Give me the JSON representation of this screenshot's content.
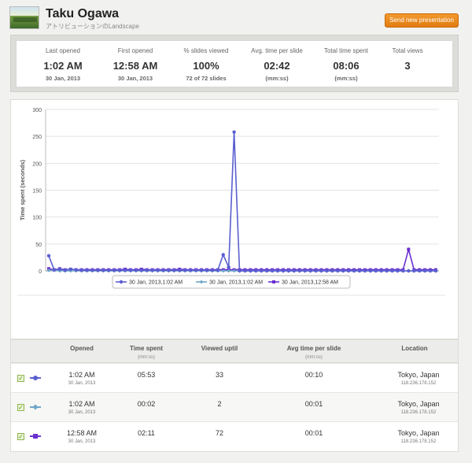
{
  "header": {
    "name": "Taku Ogawa",
    "presentation_title": "アトリビューションのLandscape",
    "send_button": "Send new presentation"
  },
  "stats": [
    {
      "label": "Last opened",
      "value": "1:02 AM",
      "sub": "30 Jan, 2013"
    },
    {
      "label": "First opened",
      "value": "12:58 AM",
      "sub": "30 Jan, 2013"
    },
    {
      "label": "% slides viewed",
      "value": "100%",
      "sub": "72 of 72 slides"
    },
    {
      "label": "Avg. time per slide",
      "value": "02:42",
      "sub": "(mm:ss)"
    },
    {
      "label": "Total time spent",
      "value": "08:06",
      "sub": "(mm:ss)"
    },
    {
      "label": "Total views",
      "value": "3",
      "sub": ""
    }
  ],
  "chart_data": {
    "type": "line",
    "ylabel": "Time spent (seconds)",
    "ylim": [
      0,
      300
    ],
    "yticks": [
      0,
      50,
      100,
      150,
      200,
      250,
      300
    ],
    "grid": true,
    "legend_position": "bottom",
    "x_count": 72,
    "series": [
      {
        "name": "30 Jan, 2013,1:02 AM",
        "color": "#5a5fcf",
        "marker": "circle",
        "values": [
          28,
          2,
          3,
          1,
          3,
          2,
          1,
          1,
          1,
          1,
          1,
          1,
          1,
          1,
          1,
          1,
          1,
          1,
          1,
          1,
          1,
          1,
          1,
          1,
          1,
          1,
          1,
          1,
          1,
          1,
          1,
          1,
          30,
          7,
          258,
          0,
          0,
          0,
          0,
          0,
          0,
          0,
          0,
          0,
          0,
          0,
          0,
          0,
          0,
          0,
          0,
          0,
          0,
          0,
          0,
          0,
          0,
          0,
          0,
          0,
          0,
          0,
          0,
          0,
          0,
          0,
          0,
          0,
          0,
          0,
          0,
          0
        ]
      },
      {
        "name": "30 Jan, 2013,1:02 AM",
        "color": "#6fa6c8",
        "marker": "diamond",
        "values": [
          1,
          1,
          0,
          0,
          0,
          0,
          0,
          0,
          0,
          0,
          0,
          0,
          0,
          0,
          0,
          0,
          0,
          0,
          0,
          0,
          0,
          0,
          0,
          0,
          0,
          0,
          0,
          0,
          0,
          0,
          0,
          0,
          0,
          0,
          0,
          0,
          0,
          0,
          0,
          0,
          0,
          0,
          0,
          0,
          0,
          0,
          0,
          0,
          0,
          0,
          0,
          0,
          0,
          0,
          0,
          0,
          0,
          0,
          0,
          0,
          0,
          0,
          0,
          0,
          0,
          0,
          0,
          0,
          0,
          0,
          0,
          0
        ]
      },
      {
        "name": "30 Jan, 2013,12:58 AM",
        "color": "#6b2fd0",
        "marker": "square",
        "values": [
          4,
          2,
          4,
          2,
          3,
          2,
          2,
          2,
          2,
          2,
          2,
          2,
          2,
          2,
          3,
          2,
          2,
          3,
          2,
          2,
          2,
          2,
          2,
          2,
          3,
          2,
          2,
          2,
          2,
          2,
          2,
          2,
          2,
          2,
          2,
          2,
          2,
          2,
          2,
          2,
          2,
          2,
          2,
          2,
          2,
          2,
          2,
          2,
          2,
          2,
          2,
          2,
          2,
          2,
          2,
          2,
          2,
          2,
          2,
          2,
          2,
          2,
          2,
          2,
          2,
          2,
          40,
          2,
          2,
          2,
          2,
          2
        ]
      }
    ]
  },
  "table": {
    "headers": {
      "opened": "Opened",
      "time_spent": "Time spent",
      "time_spent_sub": "(mm:ss)",
      "viewed_until": "Viewed uptil",
      "avg_time": "Avg time per slide",
      "avg_time_sub": "(mm:ss)",
      "location": "Location"
    },
    "rows": [
      {
        "time": "1:02 AM",
        "date": "30 Jan, 2013",
        "spent": "05:53",
        "viewed": "33",
        "avg": "00:10",
        "location": "Tokyo, Japan",
        "ip": "118.236.178.152",
        "color": "#5a5fcf",
        "checked": "✓"
      },
      {
        "time": "1:02 AM",
        "date": "30 Jan, 2013",
        "spent": "00:02",
        "viewed": "2",
        "avg": "00:01",
        "location": "Tokyo, Japan",
        "ip": "118.236.178.152",
        "color": "#6fa6c8",
        "checked": "✓"
      },
      {
        "time": "12:58 AM",
        "date": "30 Jan, 2013",
        "spent": "02:11",
        "viewed": "72",
        "avg": "00:01",
        "location": "Tokyo, Japan",
        "ip": "118.236.178.152",
        "color": "#6b2fd0",
        "checked": "✓"
      }
    ]
  }
}
